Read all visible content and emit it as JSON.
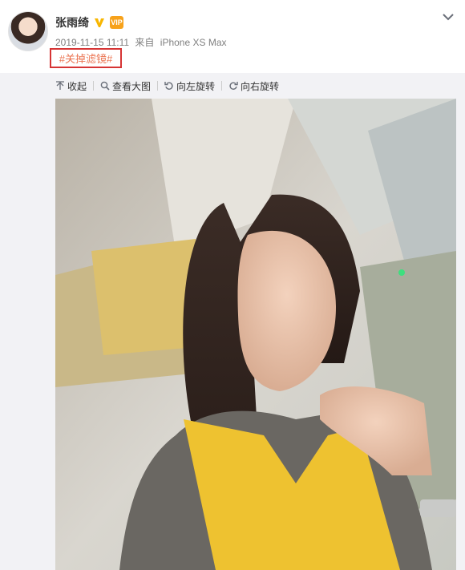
{
  "post": {
    "username": "张雨绮",
    "timestamp": "2019-11-15 11:11",
    "source_prefix": "来自",
    "device": "iPhone XS Max",
    "hashtag": "#关掉滤镜#",
    "vip_label": "VIP"
  },
  "toolbar": {
    "collapse": "收起",
    "view_large": "查看大图",
    "rotate_left": "向左旋转",
    "rotate_right": "向右旋转"
  },
  "icons": {
    "verified": "verified-v-icon",
    "vip": "vip-crown-icon",
    "menu": "chevron-down-icon",
    "collapse": "up-arrow-icon",
    "view_large": "magnifier-icon",
    "rotate_left": "rotate-left-icon",
    "rotate_right": "rotate-right-icon"
  },
  "colors": {
    "accent_link": "#eb7350",
    "highlight_box": "#d63434",
    "verified_gold": "#f8b600",
    "panel_bg": "#f2f2f5"
  }
}
